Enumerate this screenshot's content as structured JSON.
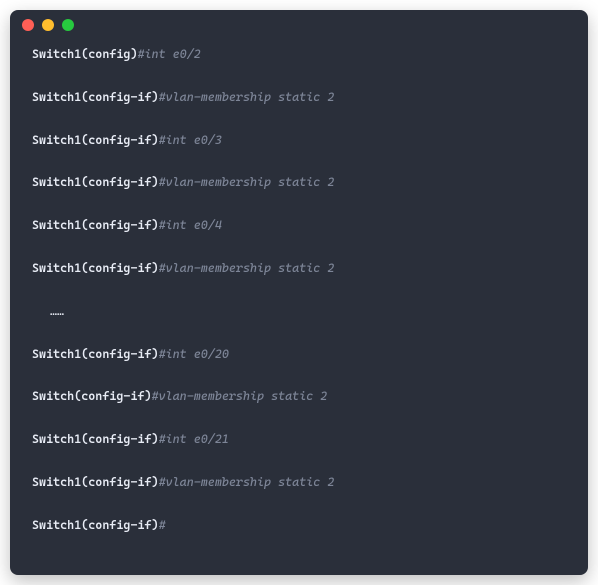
{
  "terminal": {
    "lines": [
      {
        "prompt": "Switch1(config)",
        "hash": "#",
        "command": "int e0/2"
      },
      {
        "prompt": "Switch1(config-if)",
        "hash": "#",
        "command": "vlan-membership static 2"
      },
      {
        "prompt": "Switch1(config-if)",
        "hash": "#",
        "command": "int e0/3"
      },
      {
        "prompt": "Switch1(config-if)",
        "hash": "#",
        "command": "vlan-membership static 2"
      },
      {
        "prompt": "Switch1(config-if)",
        "hash": "#",
        "command": "int e0/4"
      },
      {
        "prompt": "Switch1(config-if)",
        "hash": "#",
        "command": "vlan-membership static 2"
      },
      {
        "ellipsis": "……"
      },
      {
        "prompt": "Switch1(config-if)",
        "hash": "#",
        "command": "int e0/20"
      },
      {
        "prompt": "Switch(config-if)",
        "hash": "#",
        "command": "vlan-membership static 2"
      },
      {
        "prompt": "Switch1(config-if)",
        "hash": "#",
        "command": "int e0/21"
      },
      {
        "prompt": "Switch1(config-if)",
        "hash": "#",
        "command": "vlan-membership static 2"
      },
      {
        "prompt": "Switch1(config-if)",
        "hash": "#",
        "command": ""
      }
    ]
  }
}
